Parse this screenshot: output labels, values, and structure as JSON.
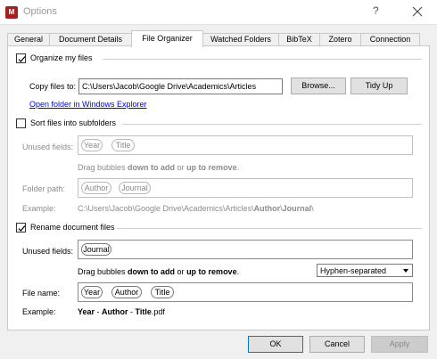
{
  "window": {
    "title": "Options",
    "help": "?",
    "app_icon_letter": "M"
  },
  "tabs": [
    {
      "label": "General"
    },
    {
      "label": "Document Details"
    },
    {
      "label": "File Organizer"
    },
    {
      "label": "Watched Folders"
    },
    {
      "label": "BibTeX"
    },
    {
      "label": "Zotero"
    },
    {
      "label": "Connection"
    }
  ],
  "organize": {
    "label": "Organize my files",
    "checked": true,
    "copy_label": "Copy files to:",
    "copy_path": "C:\\Users\\Jacob\\Google Drive\\Academics\\Articles",
    "browse": "Browse...",
    "tidy": "Tidy Up",
    "open_link": "Open folder in Windows Explorer"
  },
  "subfolders": {
    "label": "Sort files into subfolders",
    "checked": false,
    "unused_label": "Unused fields:",
    "unused": [
      "Year",
      "Title"
    ],
    "hint": {
      "pre": "Drag bubbles ",
      "b1": "down to add",
      "mid": " or ",
      "b2": "up to remove",
      "post": "."
    },
    "path_label": "Folder path:",
    "path": [
      "Author",
      "Journal"
    ],
    "example_label": "Example:",
    "example": {
      "prefix": "C:\\Users\\Jacob\\Google Drive\\Academics\\Articles\\",
      "p1": "Author",
      "sep": "\\",
      "p2": "Journal",
      "suffix": "\\"
    }
  },
  "rename": {
    "label": "Rename document files",
    "checked": true,
    "unused_label": "Unused fields:",
    "unused": [
      "Journal"
    ],
    "hint": {
      "pre": "Drag bubbles ",
      "b1": "down to add",
      "mid": " or ",
      "b2": "up to remove",
      "post": "."
    },
    "separator": "Hyphen-separated",
    "filename_label": "File name:",
    "filename": [
      "Year",
      "Author",
      "Title"
    ],
    "example_label": "Example:",
    "example": {
      "p1": "Year",
      "s1": " - ",
      "p2": "Author",
      "s2": " - ",
      "p3": "Title",
      "ext": ".pdf"
    }
  },
  "footer": {
    "ok": "OK",
    "cancel": "Cancel",
    "apply": "Apply"
  }
}
